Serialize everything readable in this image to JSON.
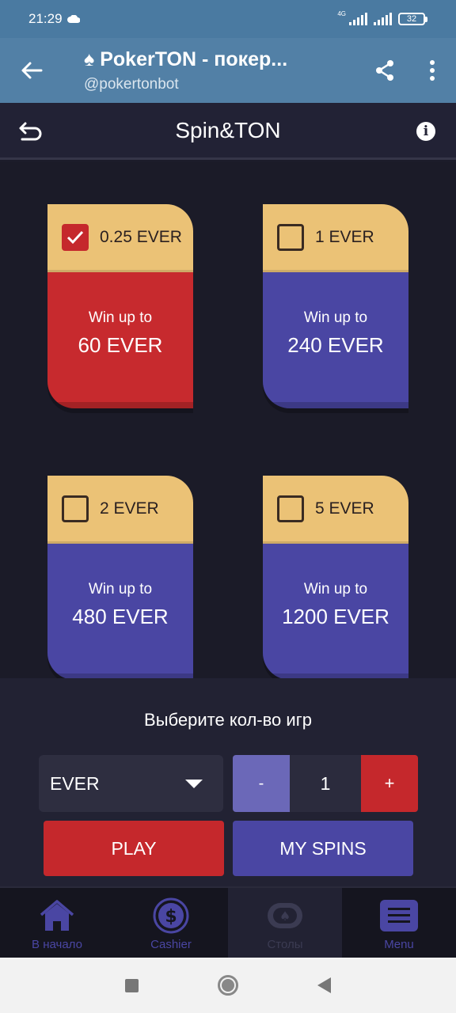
{
  "status_bar": {
    "time": "21:29",
    "network": "4G",
    "battery": "32"
  },
  "header": {
    "title": "PokerTON - покер...",
    "subtitle": "@pokertonbot",
    "back_icon": "arrow-left-icon",
    "share_icon": "share-icon",
    "more_icon": "kebab-menu-icon"
  },
  "app_header": {
    "title": "Spin&TON",
    "back_icon": "undo-arrow-icon",
    "info_icon": "info-icon"
  },
  "cards": [
    {
      "stake": "0.25 EVER",
      "win_label": "Win up to",
      "prize": "60 EVER",
      "selected": true
    },
    {
      "stake": "1 EVER",
      "win_label": "Win up to",
      "prize": "240 EVER",
      "selected": false
    },
    {
      "stake": "2 EVER",
      "win_label": "Win up to",
      "prize": "480 EVER",
      "selected": false
    },
    {
      "stake": "5 EVER",
      "win_label": "Win up to",
      "prize": "1200 EVER",
      "selected": false
    }
  ],
  "controls": {
    "choose_label": "Выберите кол-во игр",
    "currency": "EVER",
    "minus": "-",
    "count": "1",
    "plus": "+",
    "play": "PLAY",
    "my_spins": "MY SPINS"
  },
  "bottom_nav": [
    {
      "label": "В начало",
      "icon": "home-icon"
    },
    {
      "label": "Cashier",
      "icon": "dollar-icon"
    },
    {
      "label": "Столы",
      "icon": "card-table-icon"
    },
    {
      "label": "Menu",
      "icon": "menu-icon"
    }
  ],
  "colors": {
    "accent_red": "#c5282c",
    "accent_purple": "#4a46a3",
    "card_top": "#ebc276",
    "header_blue": "#5280a6"
  }
}
